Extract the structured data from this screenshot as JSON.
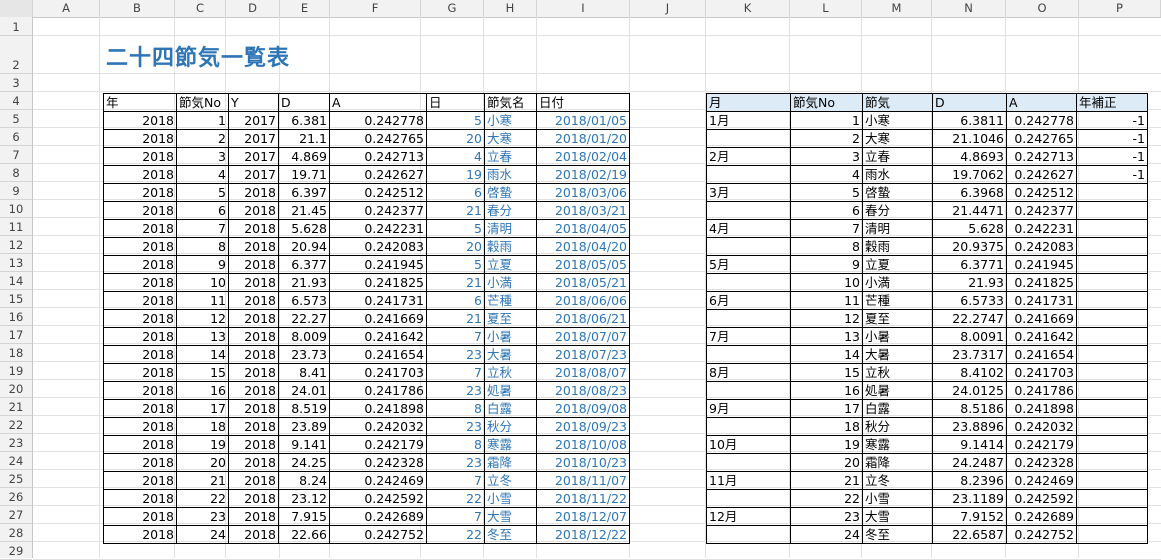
{
  "columns": [
    "A",
    "B",
    "C",
    "D",
    "E",
    "F",
    "G",
    "H",
    "I",
    "J",
    "K",
    "L",
    "M",
    "N",
    "O",
    "P"
  ],
  "rows": [
    "1",
    "2",
    "3",
    "4",
    "5",
    "6",
    "7",
    "8",
    "9",
    "10",
    "11",
    "12",
    "13",
    "14",
    "15",
    "16",
    "17",
    "18",
    "19",
    "20",
    "21",
    "22",
    "23",
    "24",
    "25",
    "26",
    "27",
    "28",
    "29"
  ],
  "title": "二十四節気一覧表",
  "left_headers": [
    "年",
    "節気No",
    "Y",
    "D",
    "A",
    "日",
    "節気名",
    "日付"
  ],
  "left_rows": [
    [
      "2018",
      "1",
      "2017",
      "6.381",
      "0.242778",
      "5",
      "小寒",
      "2018/01/05"
    ],
    [
      "2018",
      "2",
      "2017",
      "21.1",
      "0.242765",
      "20",
      "大寒",
      "2018/01/20"
    ],
    [
      "2018",
      "3",
      "2017",
      "4.869",
      "0.242713",
      "4",
      "立春",
      "2018/02/04"
    ],
    [
      "2018",
      "4",
      "2017",
      "19.71",
      "0.242627",
      "19",
      "雨水",
      "2018/02/19"
    ],
    [
      "2018",
      "5",
      "2018",
      "6.397",
      "0.242512",
      "6",
      "啓蟄",
      "2018/03/06"
    ],
    [
      "2018",
      "6",
      "2018",
      "21.45",
      "0.242377",
      "21",
      "春分",
      "2018/03/21"
    ],
    [
      "2018",
      "7",
      "2018",
      "5.628",
      "0.242231",
      "5",
      "清明",
      "2018/04/05"
    ],
    [
      "2018",
      "8",
      "2018",
      "20.94",
      "0.242083",
      "20",
      "穀雨",
      "2018/04/20"
    ],
    [
      "2018",
      "9",
      "2018",
      "6.377",
      "0.241945",
      "5",
      "立夏",
      "2018/05/05"
    ],
    [
      "2018",
      "10",
      "2018",
      "21.93",
      "0.241825",
      "21",
      "小満",
      "2018/05/21"
    ],
    [
      "2018",
      "11",
      "2018",
      "6.573",
      "0.241731",
      "6",
      "芒種",
      "2018/06/06"
    ],
    [
      "2018",
      "12",
      "2018",
      "22.27",
      "0.241669",
      "21",
      "夏至",
      "2018/06/21"
    ],
    [
      "2018",
      "13",
      "2018",
      "8.009",
      "0.241642",
      "7",
      "小暑",
      "2018/07/07"
    ],
    [
      "2018",
      "14",
      "2018",
      "23.73",
      "0.241654",
      "23",
      "大暑",
      "2018/07/23"
    ],
    [
      "2018",
      "15",
      "2018",
      "8.41",
      "0.241703",
      "7",
      "立秋",
      "2018/08/07"
    ],
    [
      "2018",
      "16",
      "2018",
      "24.01",
      "0.241786",
      "23",
      "処暑",
      "2018/08/23"
    ],
    [
      "2018",
      "17",
      "2018",
      "8.519",
      "0.241898",
      "8",
      "白露",
      "2018/09/08"
    ],
    [
      "2018",
      "18",
      "2018",
      "23.89",
      "0.242032",
      "23",
      "秋分",
      "2018/09/23"
    ],
    [
      "2018",
      "19",
      "2018",
      "9.141",
      "0.242179",
      "8",
      "寒露",
      "2018/10/08"
    ],
    [
      "2018",
      "20",
      "2018",
      "24.25",
      "0.242328",
      "23",
      "霜降",
      "2018/10/23"
    ],
    [
      "2018",
      "21",
      "2018",
      "8.24",
      "0.242469",
      "7",
      "立冬",
      "2018/11/07"
    ],
    [
      "2018",
      "22",
      "2018",
      "23.12",
      "0.242592",
      "22",
      "小雪",
      "2018/11/22"
    ],
    [
      "2018",
      "23",
      "2018",
      "7.915",
      "0.242689",
      "7",
      "大雪",
      "2018/12/07"
    ],
    [
      "2018",
      "24",
      "2018",
      "22.66",
      "0.242752",
      "22",
      "冬至",
      "2018/12/22"
    ]
  ],
  "right_headers": [
    "月",
    "節気No",
    "節気",
    "D",
    "A",
    "年補正"
  ],
  "right_rows": [
    [
      "1月",
      "1",
      "小寒",
      "6.3811",
      "0.242778",
      "-1"
    ],
    [
      "",
      "2",
      "大寒",
      "21.1046",
      "0.242765",
      "-1"
    ],
    [
      "2月",
      "3",
      "立春",
      "4.8693",
      "0.242713",
      "-1"
    ],
    [
      "",
      "4",
      "雨水",
      "19.7062",
      "0.242627",
      "-1"
    ],
    [
      "3月",
      "5",
      "啓蟄",
      "6.3968",
      "0.242512",
      ""
    ],
    [
      "",
      "6",
      "春分",
      "21.4471",
      "0.242377",
      ""
    ],
    [
      "4月",
      "7",
      "清明",
      "5.628",
      "0.242231",
      ""
    ],
    [
      "",
      "8",
      "穀雨",
      "20.9375",
      "0.242083",
      ""
    ],
    [
      "5月",
      "9",
      "立夏",
      "6.3771",
      "0.241945",
      ""
    ],
    [
      "",
      "10",
      "小満",
      "21.93",
      "0.241825",
      ""
    ],
    [
      "6月",
      "11",
      "芒種",
      "6.5733",
      "0.241731",
      ""
    ],
    [
      "",
      "12",
      "夏至",
      "22.2747",
      "0.241669",
      ""
    ],
    [
      "7月",
      "13",
      "小暑",
      "8.0091",
      "0.241642",
      ""
    ],
    [
      "",
      "14",
      "大暑",
      "23.7317",
      "0.241654",
      ""
    ],
    [
      "8月",
      "15",
      "立秋",
      "8.4102",
      "0.241703",
      ""
    ],
    [
      "",
      "16",
      "処暑",
      "24.0125",
      "0.241786",
      ""
    ],
    [
      "9月",
      "17",
      "白露",
      "8.5186",
      "0.241898",
      ""
    ],
    [
      "",
      "18",
      "秋分",
      "23.8896",
      "0.242032",
      ""
    ],
    [
      "10月",
      "19",
      "寒露",
      "9.1414",
      "0.242179",
      ""
    ],
    [
      "",
      "20",
      "霜降",
      "24.2487",
      "0.242328",
      ""
    ],
    [
      "11月",
      "21",
      "立冬",
      "8.2396",
      "0.242469",
      ""
    ],
    [
      "",
      "22",
      "小雪",
      "23.1189",
      "0.242592",
      ""
    ],
    [
      "12月",
      "23",
      "大雪",
      "7.9152",
      "0.242689",
      ""
    ],
    [
      "",
      "24",
      "冬至",
      "22.6587",
      "0.242752",
      ""
    ]
  ],
  "colors": {
    "title": "#2e75b6",
    "link_blue": "#2e75b6",
    "header_fill": "#ddebf7"
  }
}
